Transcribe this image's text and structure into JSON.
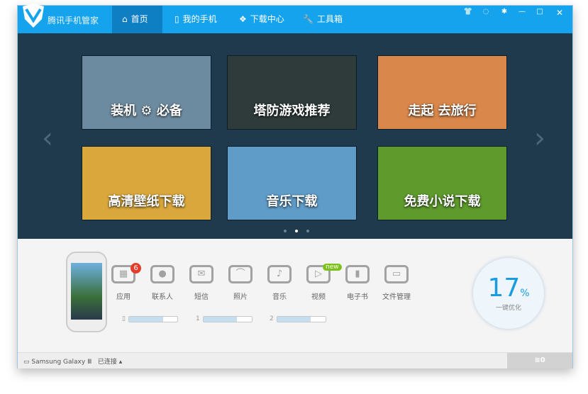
{
  "app": {
    "title": "腾讯手机管家"
  },
  "tabs": [
    {
      "label": "首页",
      "icon": "home-icon",
      "active": true
    },
    {
      "label": "我的手机",
      "icon": "phone-icon"
    },
    {
      "label": "下载中心",
      "icon": "download-icon"
    },
    {
      "label": "工具箱",
      "icon": "wrench-icon"
    }
  ],
  "window_controls": [
    "skin-icon",
    "feedback-icon",
    "settings-icon",
    "minimize-icon",
    "maximize-icon",
    "close-icon"
  ],
  "tiles": [
    {
      "label": "装机 ⚙ 必备",
      "bg": "#6d8ba0"
    },
    {
      "label": "塔防游戏推荐",
      "bg": "#2e3b3a"
    },
    {
      "label": "走起 去旅行",
      "bg": "#d9874a"
    },
    {
      "label": "高清壁纸下载",
      "bg": "#d9a73c"
    },
    {
      "label": "音乐下载",
      "bg": "#5f9cc8"
    },
    {
      "label": "免费小说下载",
      "bg": "#5e9a2c"
    }
  ],
  "features": [
    {
      "label": "应用",
      "badge": "6",
      "glyph": "▦"
    },
    {
      "label": "联系人",
      "glyph": "●"
    },
    {
      "label": "短信",
      "glyph": "✉"
    },
    {
      "label": "照片",
      "glyph": "⌒"
    },
    {
      "label": "音乐",
      "glyph": "♪"
    },
    {
      "label": "视频",
      "badge_new": "new",
      "glyph": "▷"
    },
    {
      "label": "电子书",
      "glyph": "▮"
    },
    {
      "label": "文件管理",
      "glyph": "▭"
    }
  ],
  "storage": [
    {
      "icon": "phone-storage-icon",
      "glyph": "▯",
      "fill": 0.7
    },
    {
      "icon": "sdcard-1-icon",
      "glyph": "1",
      "fill": 0.7
    },
    {
      "icon": "sdcard-2-icon",
      "glyph": "2",
      "fill": 0.7
    }
  ],
  "optimize": {
    "value": "17",
    "unit": "%",
    "label": "一键优化"
  },
  "status": {
    "device": "Samsung Galaxy Ⅲ",
    "state": "已连接 ▴",
    "count": "0"
  },
  "colors": {
    "titlebar": "#16a3ee",
    "active_tab": "#0f7fc3",
    "stage": "#1f3a4c",
    "accent": "#1a9ce0"
  }
}
